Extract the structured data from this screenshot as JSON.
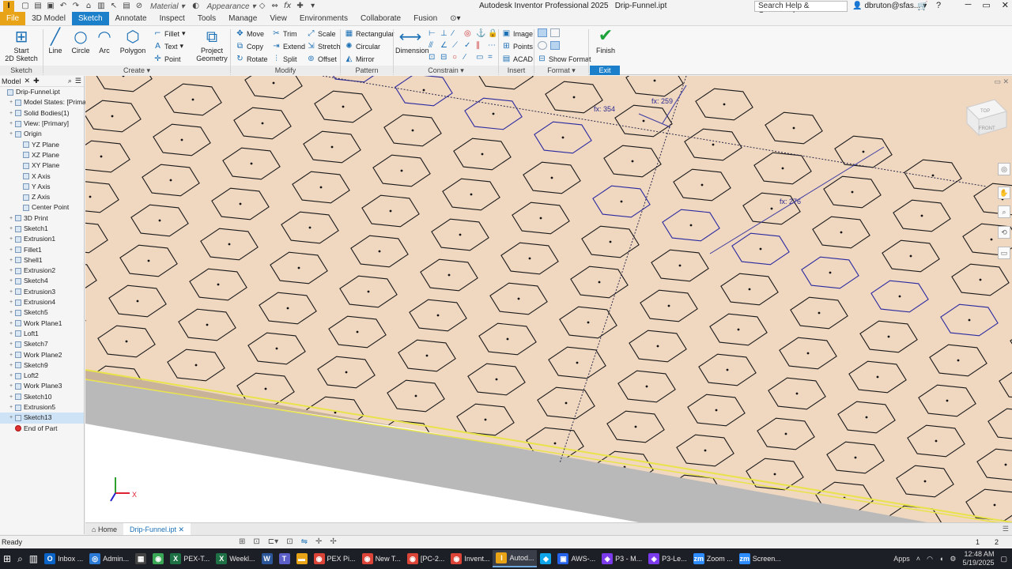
{
  "titlebar": {
    "logo": "I",
    "material": "Material",
    "appearance": "Appearance",
    "title": "Autodesk Inventor Professional 2025",
    "file": "Drip-Funnel.ipt",
    "search": "Search Help & Commands...",
    "user": "dbruton@sfas...",
    "fx": "fx"
  },
  "ribbon_tabs": [
    "File",
    "3D Model",
    "Sketch",
    "Annotate",
    "Inspect",
    "Tools",
    "Manage",
    "View",
    "Environments",
    "Collaborate",
    "Fusion"
  ],
  "ribbon": {
    "sketch_panel": {
      "title": "Sketch",
      "start": "Start",
      "start2": "2D Sketch"
    },
    "create_panel": {
      "title": "Create",
      "line": "Line",
      "circle": "Circle",
      "arc": "Arc",
      "polygon": "Polygon",
      "fillet": "Fillet",
      "text": "Text",
      "point": "Point",
      "project": "Project",
      "project2": "Geometry"
    },
    "modify_panel": {
      "title": "Modify",
      "move": "Move",
      "trim": "Trim",
      "scale": "Scale",
      "copy": "Copy",
      "extend": "Extend",
      "stretch": "Stretch",
      "rotate": "Rotate",
      "split": "Split",
      "offset": "Offset"
    },
    "pattern_panel": {
      "title": "Pattern",
      "rectangular": "Rectangular",
      "circular": "Circular",
      "mirror": "Mirror"
    },
    "constrain_panel": {
      "title": "Constrain",
      "dimension": "Dimension"
    },
    "insert_panel": {
      "title": "Insert",
      "image": "Image",
      "points": "Points",
      "acad": "ACAD"
    },
    "format_panel": {
      "title": "Format",
      "show_format": "Show Format"
    },
    "exit_panel": {
      "title": "Exit",
      "finish": "Finish"
    }
  },
  "browser": {
    "tab": "Model",
    "items": [
      {
        "label": "Drip-Funnel.ipt",
        "level": 0
      },
      {
        "label": "Model States: [Primary]",
        "level": 1
      },
      {
        "label": "Solid Bodies(1)",
        "level": 1
      },
      {
        "label": "View: [Primary]",
        "level": 1
      },
      {
        "label": "Origin",
        "level": 1
      },
      {
        "label": "YZ Plane",
        "level": 2
      },
      {
        "label": "XZ Plane",
        "level": 2
      },
      {
        "label": "XY Plane",
        "level": 2
      },
      {
        "label": "X Axis",
        "level": 2
      },
      {
        "label": "Y Axis",
        "level": 2
      },
      {
        "label": "Z Axis",
        "level": 2
      },
      {
        "label": "Center Point",
        "level": 2
      },
      {
        "label": "3D Print",
        "level": 1
      },
      {
        "label": "Sketch1",
        "level": 1
      },
      {
        "label": "Extrusion1",
        "level": 1
      },
      {
        "label": "Fillet1",
        "level": 1
      },
      {
        "label": "Shell1",
        "level": 1
      },
      {
        "label": "Extrusion2",
        "level": 1
      },
      {
        "label": "Sketch4",
        "level": 1
      },
      {
        "label": "Extrusion3",
        "level": 1
      },
      {
        "label": "Extrusion4",
        "level": 1
      },
      {
        "label": "Sketch5",
        "level": 1
      },
      {
        "label": "Work Plane1",
        "level": 1
      },
      {
        "label": "Loft1",
        "level": 1
      },
      {
        "label": "Sketch7",
        "level": 1
      },
      {
        "label": "Work Plane2",
        "level": 1
      },
      {
        "label": "Sketch9",
        "level": 1
      },
      {
        "label": "Loft2",
        "level": 1
      },
      {
        "label": "Work Plane3",
        "level": 1
      },
      {
        "label": "Sketch10",
        "level": 1
      },
      {
        "label": "Extrusion5",
        "level": 1
      },
      {
        "label": "Sketch13",
        "level": 1,
        "selected": true
      },
      {
        "label": "End of Part",
        "level": 1,
        "end": true
      }
    ]
  },
  "viewport": {
    "dims": [
      "fx: 354",
      "fx: 259",
      "fx: 276"
    ],
    "viewcube": {
      "top": "TOP",
      "front": "FRONT"
    },
    "triad": {
      "x": "X"
    }
  },
  "doc_tabs": {
    "home": "Home",
    "file": "Drip-Funnel.ipt"
  },
  "status": {
    "text": "Ready",
    "n1": "1",
    "n2": "2"
  },
  "taskbar": {
    "items": [
      {
        "label": "Inbox ...",
        "icon": "O",
        "color": "#0a64c8"
      },
      {
        "label": "Admin...",
        "icon": "◎",
        "color": "#2a7ad5"
      },
      {
        "label": "",
        "icon": "▦",
        "color": "#444"
      },
      {
        "label": "",
        "icon": "◉",
        "color": "#3aa757"
      },
      {
        "label": "PEX-T...",
        "icon": "X",
        "color": "#1e7145"
      },
      {
        "label": "Weekl...",
        "icon": "X",
        "color": "#1e7145"
      },
      {
        "label": "",
        "icon": "W",
        "color": "#2b579a"
      },
      {
        "label": "",
        "icon": "T",
        "color": "#5b5fc7"
      },
      {
        "label": "",
        "icon": "▬",
        "color": "#e8a317"
      },
      {
        "label": "PEX Pi...",
        "icon": "◉",
        "color": "#db4437"
      },
      {
        "label": "New T...",
        "icon": "◉",
        "color": "#db4437"
      },
      {
        "label": "[PC-2...",
        "icon": "◉",
        "color": "#db4437"
      },
      {
        "label": "Invent...",
        "icon": "◉",
        "color": "#db4437"
      },
      {
        "label": "Autod...",
        "icon": "I",
        "color": "#e8a317",
        "active": true
      },
      {
        "label": "",
        "icon": "◆",
        "color": "#0ea5e9"
      },
      {
        "label": "AWS-...",
        "icon": "▣",
        "color": "#2563eb"
      },
      {
        "label": "P3 - M...",
        "icon": "◈",
        "color": "#7c3aed"
      },
      {
        "label": "P3-Le...",
        "icon": "◈",
        "color": "#7c3aed"
      },
      {
        "label": "Zoom ...",
        "icon": "zm",
        "color": "#2d8cff"
      },
      {
        "label": "Screen...",
        "icon": "zm",
        "color": "#2d8cff"
      }
    ],
    "apps": "Apps",
    "time": "12:48 AM",
    "date": "5/19/2025"
  }
}
